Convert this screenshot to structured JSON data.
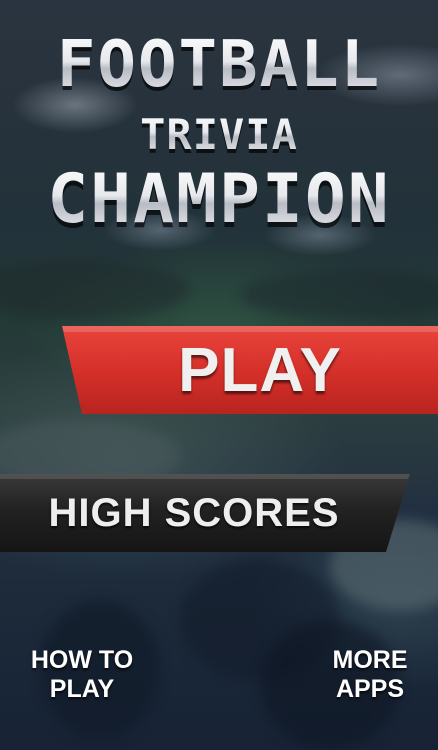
{
  "title": {
    "line1": "FOOTBALL",
    "line2": "TRIVIA",
    "line3": "CHAMPION"
  },
  "menu": {
    "play_label": "PLAY",
    "high_scores_label": "HIGH SCORES"
  },
  "footer": {
    "how_to_play_line1": "HOW TO",
    "how_to_play_line2": "PLAY",
    "more_apps_line1": "MORE",
    "more_apps_line2": "APPS"
  },
  "colors": {
    "play_red": "#d8322c",
    "high_scores_dark": "#1c1c1c"
  }
}
